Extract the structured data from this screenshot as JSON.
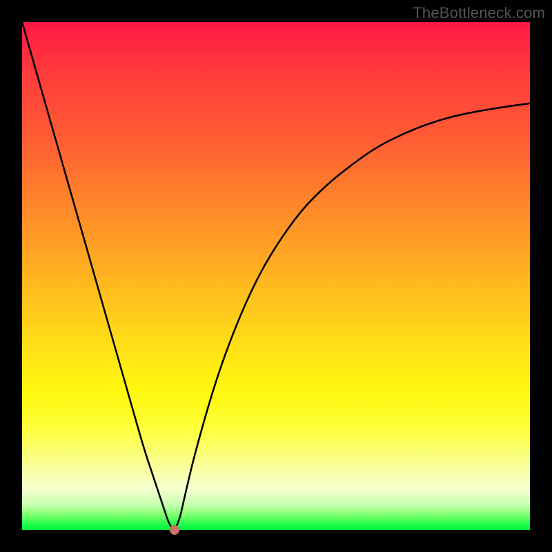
{
  "watermark": "TheBottleneck.com",
  "chart_data": {
    "type": "line",
    "title": "",
    "xlabel": "",
    "ylabel": "",
    "xlim": [
      0,
      100
    ],
    "ylim": [
      0,
      100
    ],
    "series": [
      {
        "name": "bottleneck-curve",
        "x": [
          0,
          2,
          4,
          6,
          8,
          10,
          12,
          14,
          16,
          18,
          20,
          22,
          24,
          26,
          28,
          29,
          30,
          31,
          32,
          34,
          38,
          42,
          46,
          50,
          55,
          60,
          65,
          70,
          75,
          80,
          85,
          90,
          95,
          100
        ],
        "values": [
          100,
          93,
          86,
          79,
          72,
          65,
          58,
          51,
          44,
          37,
          30,
          23,
          16,
          10,
          4,
          1,
          0,
          2,
          6.5,
          15,
          29,
          40,
          49,
          56,
          63,
          68,
          72,
          75.5,
          78,
          80,
          81.5,
          82.5,
          83.3,
          84
        ]
      }
    ],
    "marker": {
      "x": 30,
      "y": 0,
      "color": "#c97765"
    },
    "background_gradient": {
      "stops": [
        {
          "pct": 0,
          "color": "#ff1847"
        },
        {
          "pct": 10,
          "color": "#ff3b3b"
        },
        {
          "pct": 22,
          "color": "#ff5a34"
        },
        {
          "pct": 33,
          "color": "#ff7d2c"
        },
        {
          "pct": 45,
          "color": "#ffa324"
        },
        {
          "pct": 55,
          "color": "#ffc41d"
        },
        {
          "pct": 65,
          "color": "#ffe316"
        },
        {
          "pct": 73,
          "color": "#fff80f"
        },
        {
          "pct": 80,
          "color": "#fdff3a"
        },
        {
          "pct": 88,
          "color": "#faffa0"
        },
        {
          "pct": 92,
          "color": "#f4ffd0"
        },
        {
          "pct": 95,
          "color": "#c8ffb0"
        },
        {
          "pct": 97,
          "color": "#7fff70"
        },
        {
          "pct": 99,
          "color": "#1cff49"
        },
        {
          "pct": 100,
          "color": "#00ee3b"
        }
      ]
    }
  }
}
